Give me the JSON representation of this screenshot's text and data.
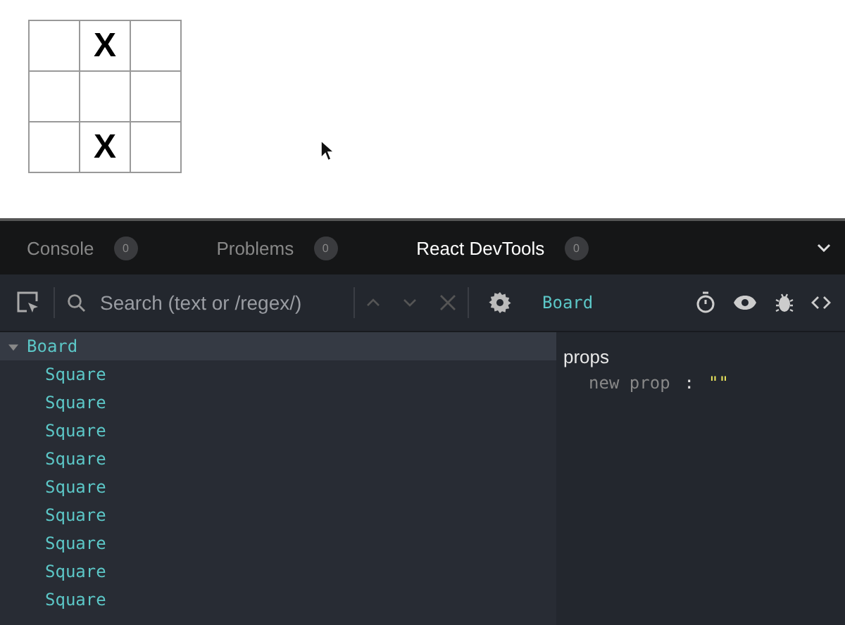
{
  "board": {
    "squares": [
      {
        "kind": "empty"
      },
      {
        "kind": "marked",
        "mark": "X"
      },
      {
        "kind": "empty"
      },
      {
        "kind": "empty"
      },
      {
        "kind": "empty"
      },
      {
        "kind": "empty"
      },
      {
        "kind": "empty"
      },
      {
        "kind": "marked",
        "mark": "X"
      },
      {
        "kind": "empty"
      }
    ]
  },
  "panel_tabs": [
    {
      "label": "Console",
      "count": "0",
      "selected": false
    },
    {
      "label": "Problems",
      "count": "0",
      "selected": false
    },
    {
      "label": "React DevTools",
      "count": "0",
      "selected": true
    }
  ],
  "toolbar": {
    "search": {
      "placeholder": "Search (text or /regex/)"
    },
    "selected_component": "Board"
  },
  "tree": [
    {
      "name": "Board",
      "expanded": true,
      "selected": true,
      "children": [
        {
          "name": "Square"
        },
        {
          "name": "Square"
        },
        {
          "name": "Square"
        },
        {
          "name": "Square"
        },
        {
          "name": "Square"
        },
        {
          "name": "Square"
        },
        {
          "name": "Square"
        },
        {
          "name": "Square"
        },
        {
          "name": "Square"
        }
      ]
    }
  ],
  "props": {
    "heading": "props",
    "items": [
      {
        "key": "new prop",
        "separator": ":",
        "value": "\"\""
      }
    ]
  }
}
